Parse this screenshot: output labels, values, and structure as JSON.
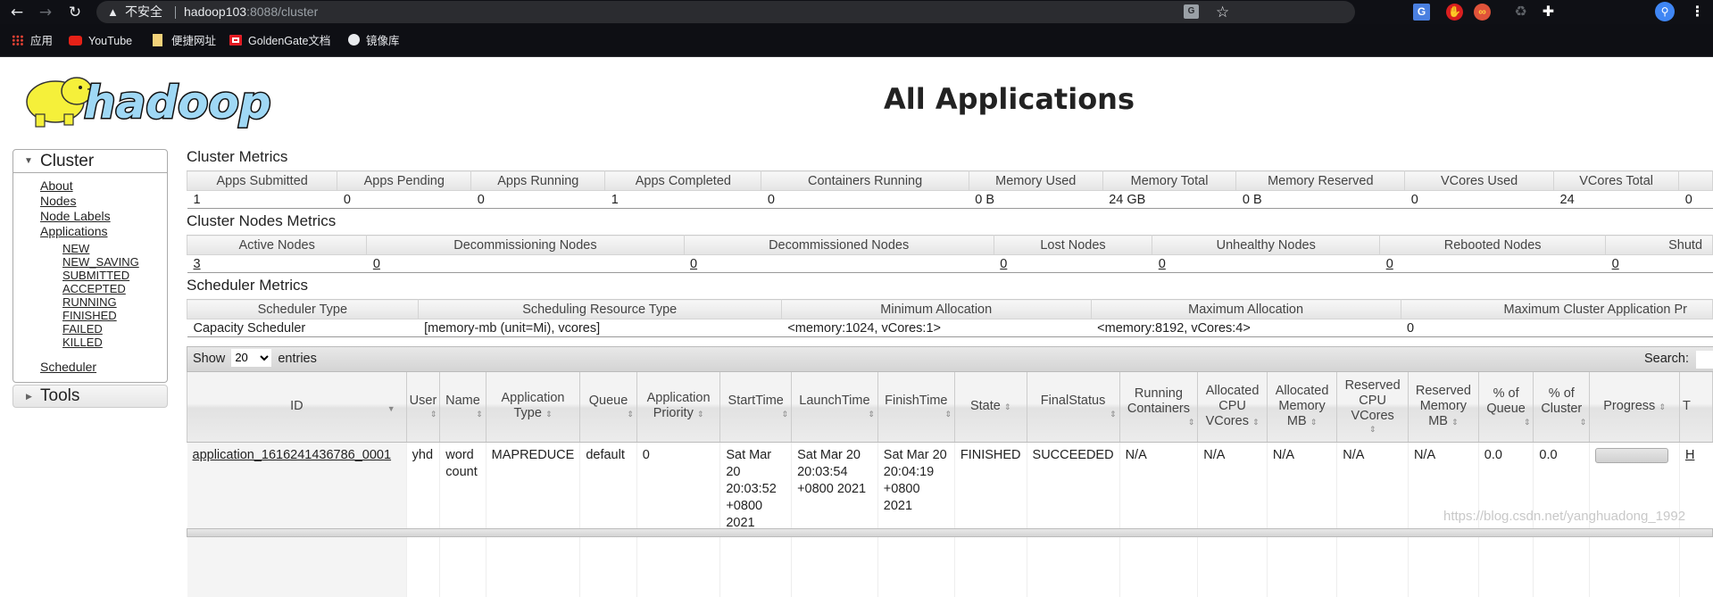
{
  "browser": {
    "security_label": "不安全",
    "url_host": "hadoop103",
    "url_path": ":8088/cluster",
    "bookmarks": [
      {
        "label": "应用",
        "icon": "apps-grid-icon"
      },
      {
        "label": "YouTube",
        "icon": "youtube-icon"
      },
      {
        "label": "便捷网址",
        "icon": "folder-icon"
      },
      {
        "label": "GoldenGate文档",
        "icon": "oracle-icon"
      },
      {
        "label": "镜像库",
        "icon": "globe-icon"
      }
    ],
    "extensions": [
      "google-translate-icon",
      "adblock-icon",
      "infinity-icon",
      "recycle-icon",
      "puzzle-icon",
      "profile-avatar-icon",
      "menu-icon"
    ]
  },
  "header": {
    "logo_text": "hadoop",
    "title": "All Applications"
  },
  "sidebar": {
    "cluster_label": "Cluster",
    "links": [
      "About",
      "Nodes",
      "Node Labels",
      "Applications"
    ],
    "app_states": [
      "NEW",
      "NEW_SAVING",
      "SUBMITTED",
      "ACCEPTED",
      "RUNNING",
      "FINISHED",
      "FAILED",
      "KILLED"
    ],
    "scheduler_label": "Scheduler",
    "tools_label": "Tools"
  },
  "cluster_metrics": {
    "title": "Cluster Metrics",
    "headers": [
      "Apps Submitted",
      "Apps Pending",
      "Apps Running",
      "Apps Completed",
      "Containers Running",
      "Memory Used",
      "Memory Total",
      "Memory Reserved",
      "VCores Used",
      "VCores Total",
      ""
    ],
    "values": [
      "1",
      "0",
      "0",
      "1",
      "0",
      "0 B",
      "24 GB",
      "0 B",
      "0",
      "24",
      "0"
    ]
  },
  "cluster_nodes_metrics": {
    "title": "Cluster Nodes Metrics",
    "headers": [
      "Active Nodes",
      "Decommissioning Nodes",
      "Decommissioned Nodes",
      "Lost Nodes",
      "Unhealthy Nodes",
      "Rebooted Nodes",
      "Shutd"
    ],
    "values": [
      "3",
      "0",
      "0",
      "0",
      "0",
      "0",
      "0"
    ]
  },
  "scheduler_metrics": {
    "title": "Scheduler Metrics",
    "headers": [
      "Scheduler Type",
      "Scheduling Resource Type",
      "Minimum Allocation",
      "Maximum Allocation",
      "Maximum Cluster Application Pr"
    ],
    "values": [
      "Capacity Scheduler",
      "[memory-mb (unit=Mi), vcores]",
      "<memory:1024, vCores:1>",
      "<memory:8192, vCores:4>",
      "0"
    ]
  },
  "apps_table": {
    "show_label": "Show",
    "entries_label": "entries",
    "page_size": "20",
    "page_size_options": [
      "20"
    ],
    "search_label": "Search:",
    "search_value": "",
    "headers": [
      "ID",
      "User",
      "Name",
      "Application Type",
      "Queue",
      "Application Priority",
      "StartTime",
      "LaunchTime",
      "FinishTime",
      "State",
      "FinalStatus",
      "Running Containers",
      "Allocated CPU VCores",
      "Allocated Memory MB",
      "Reserved CPU VCores",
      "Reserved Memory MB",
      "% of Queue",
      "% of Cluster",
      "Progress",
      "T"
    ],
    "rows": [
      {
        "id": "application_1616241436786_0001",
        "user": "yhd",
        "name": "word count",
        "type": "MAPREDUCE",
        "queue": "default",
        "priority": "0",
        "start_time": "Sat Mar 20 20:03:52 +0800 2021",
        "launch_time": "Sat Mar 20 20:03:54 +0800 2021",
        "finish_time": "Sat Mar 20 20:04:19 +0800 2021",
        "state": "FINISHED",
        "final_status": "SUCCEEDED",
        "running_containers": "N/A",
        "alloc_vcores": "N/A",
        "alloc_memory": "N/A",
        "reserved_vcores": "N/A",
        "reserved_memory": "N/A",
        "pct_queue": "0.0",
        "pct_cluster": "0.0",
        "progress": 0,
        "tracking_ui": "H"
      }
    ]
  },
  "watermark": "https://blog.csdn.net/yanghuadong_1992"
}
